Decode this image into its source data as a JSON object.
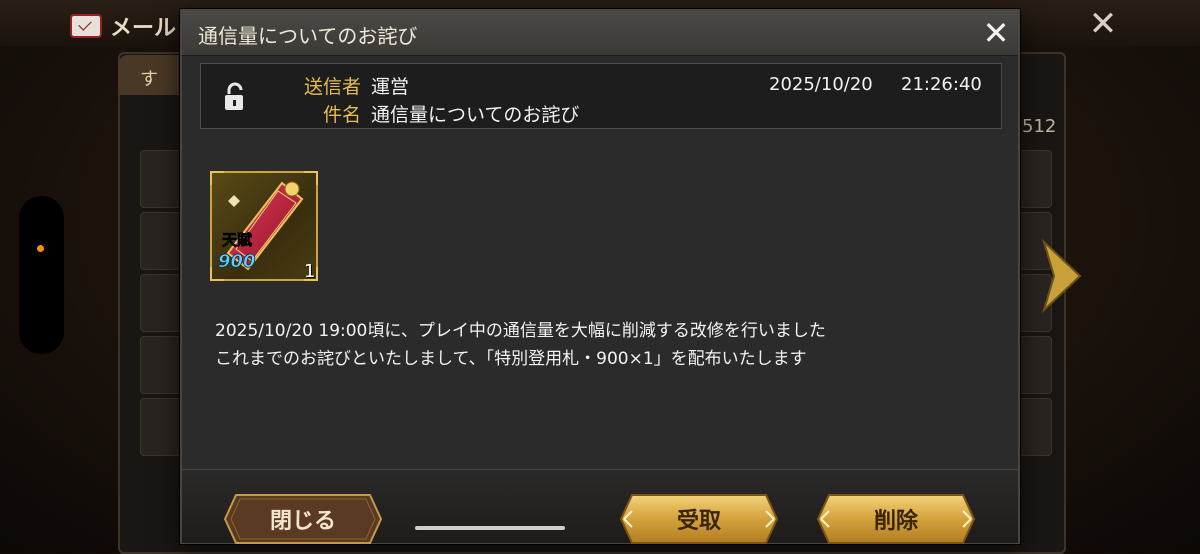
{
  "background": {
    "screen_title": "メール",
    "tab_label": "す",
    "mail_count": "512",
    "close_symbol": "✕"
  },
  "dialog": {
    "title": "通信量についてのお詫び",
    "close_symbol": "✕",
    "sender_label": "送信者",
    "sender_value": "運営",
    "subject_label": "件名",
    "subject_value": "通信量についてのお詫び",
    "date": "2025/10/20",
    "time": "21:26:40",
    "lock_icon": "lock-open-icon",
    "attachment": {
      "icon": "talent-scroll-icon",
      "label": "天賦",
      "value": "900",
      "quantity": "1"
    },
    "message_lines": [
      "2025/10/20 19:00頃に、プレイ中の通信量を大幅に削減する改修を行いました",
      "これまでのお詫びといたしまして、「特別登用札・900×1」を配布いたします"
    ]
  },
  "buttons": {
    "close_label": "閉じる",
    "receive_label": "受取",
    "delete_label": "削除"
  },
  "colors": {
    "label_gold": "#e6bd4f",
    "button_gold": "#d4a23c",
    "button_dark": "#5a3a22"
  }
}
